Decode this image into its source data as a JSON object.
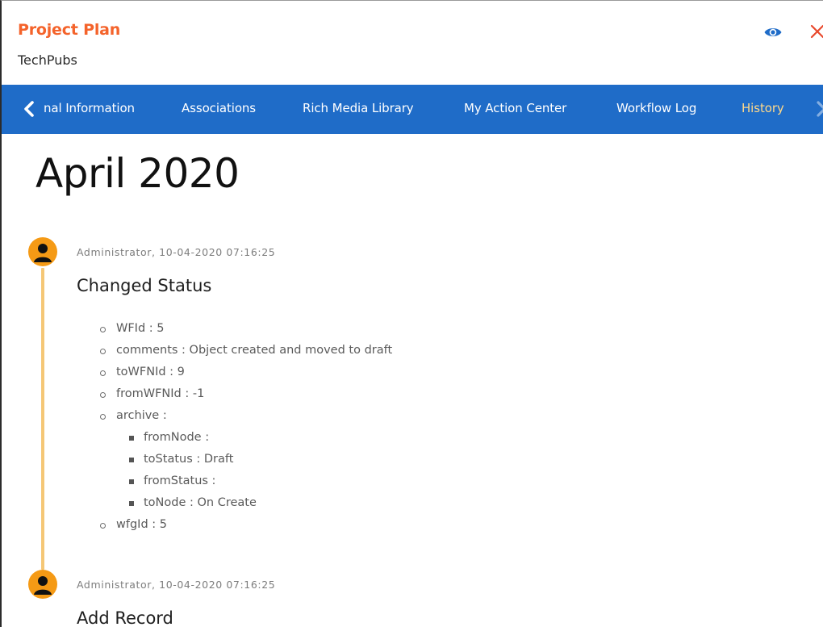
{
  "header": {
    "title": "Project Plan",
    "subtitle": "TechPubs",
    "view_icon": "eye-icon",
    "close_icon": "close-icon"
  },
  "tabs": {
    "items": [
      {
        "label": "nal Information",
        "active": false
      },
      {
        "label": "Associations",
        "active": false
      },
      {
        "label": "Rich Media Library",
        "active": false
      },
      {
        "label": "My Action Center",
        "active": false
      },
      {
        "label": "Workflow Log",
        "active": false
      },
      {
        "label": "History",
        "active": true
      }
    ],
    "prev_icon": "chevron-left-icon",
    "next_icon": "chevron-right-icon"
  },
  "history": {
    "month": "April 2020",
    "entries": [
      {
        "meta": "Administrator, 10-04-2020 07:16:25",
        "title": "Changed Status",
        "details": [
          {
            "level": 1,
            "text": "WFId : 5"
          },
          {
            "level": 1,
            "text": "comments : Object created and moved to draft"
          },
          {
            "level": 1,
            "text": "toWFNId : 9"
          },
          {
            "level": 1,
            "text": "fromWFNId : -1"
          },
          {
            "level": 1,
            "text": "archive :"
          },
          {
            "level": 2,
            "text": "fromNode :"
          },
          {
            "level": 2,
            "text": "toStatus : Draft"
          },
          {
            "level": 2,
            "text": "fromStatus :"
          },
          {
            "level": 2,
            "text": "toNode : On Create"
          },
          {
            "level": 1,
            "text": "wfgId : 5"
          }
        ]
      },
      {
        "meta": "Administrator, 10-04-2020 07:16:25",
        "title": "Add Record",
        "details": []
      }
    ]
  },
  "colors": {
    "title": "#f4632b",
    "tabbar": "#1f6cc8",
    "active_tab": "#ffd98a",
    "avatar": "#f59a15",
    "timeline": "#f5c776",
    "eye": "#1f6cc8",
    "close": "#e8482c"
  }
}
